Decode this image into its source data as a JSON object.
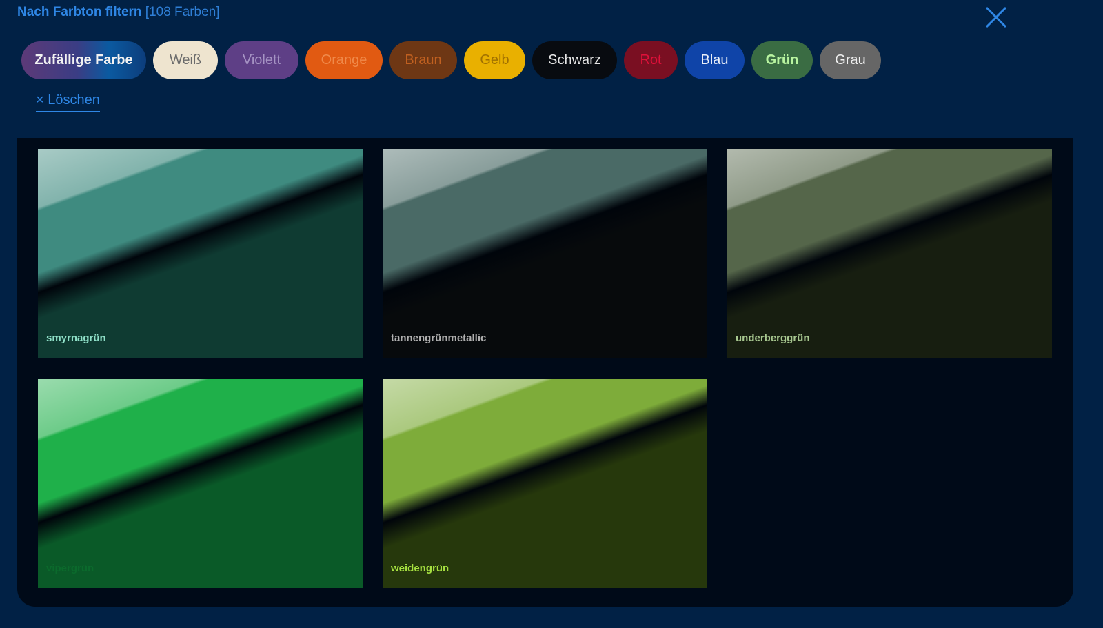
{
  "header": {
    "title": "Nach Farbton filtern",
    "count": "[108 Farben]"
  },
  "close_icon": "close-icon",
  "pills": [
    {
      "label": "Zufällige Farbe"
    },
    {
      "label": "Weiß"
    },
    {
      "label": "Violett"
    },
    {
      "label": "Orange"
    },
    {
      "label": "Braun"
    },
    {
      "label": "Gelb"
    },
    {
      "label": "Schwarz"
    },
    {
      "label": "Rot"
    },
    {
      "label": "Blau"
    },
    {
      "label": "Grün"
    },
    {
      "label": "Grau"
    }
  ],
  "clear": {
    "label": "× Löschen"
  },
  "swatches": [
    {
      "name": "smyrnagrün",
      "top": "#3f8b80",
      "bottom": "#0f3b32",
      "label_color": "#8fe0c8"
    },
    {
      "name": "tannengrünmetallic",
      "top": "#4a6a66",
      "bottom": "#070a0c",
      "label_color": "#b0b0b0"
    },
    {
      "name": "underberggrün",
      "top": "#55664a",
      "bottom": "#171e10",
      "label_color": "#a8c890"
    },
    {
      "name": "vipergrün",
      "top": "#1fb04a",
      "bottom": "#0a5a28",
      "label_color": "#0b6a2c"
    },
    {
      "name": "weidengrün",
      "top": "#7eac3a",
      "bottom": "#26380c",
      "label_color": "#a6e040"
    }
  ]
}
